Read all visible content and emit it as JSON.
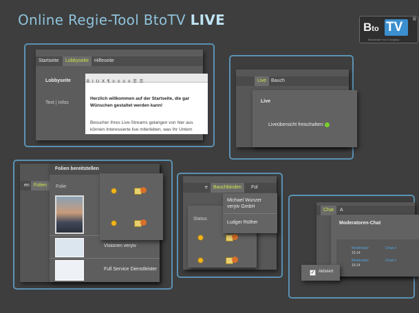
{
  "header": {
    "title": "Online Regie-Tool BtoTV",
    "title_strong": "LIVE"
  },
  "logo": {
    "left": "B",
    "left_small": "to",
    "right": "TV",
    "reg": "®",
    "tagline": "Broadcast Your Company",
    "accent": "#3b8fcf"
  },
  "colors": {
    "frame": "#5a92b4",
    "active_tab": "#cde84a",
    "status_dot": "#f2b515",
    "live_dot": "#77d22a"
  },
  "panel1": {
    "tabs": [
      "Startseite",
      "Lobbyseite",
      "Hilfeseite"
    ],
    "section_label": "Lobbyseite",
    "field_label": "Text | Infos",
    "toolbar": [
      "B",
      "I",
      "U",
      "X",
      "¶",
      "≡",
      "≡",
      "≡",
      "≡",
      "☰",
      "☰"
    ],
    "heading": "Herzlich willkommen auf der Startseite, die gar Wünschen gestaltet werden kann!",
    "body": "Besucher Ihres Live-Streams gelangen von hier aus können Interessierte live miterleben, was Ihr Untern"
  },
  "panel2": {
    "tabs": [
      "Live",
      "Bauch"
    ],
    "section_label": "Live",
    "field_label": "Liveübersicht freischalten:"
  },
  "panel3": {
    "title": "Folien bereitstellen",
    "tabs": [
      "en",
      "Folien"
    ],
    "col_label": "Folie",
    "rows": [
      "Visionen veryiv",
      "Full Service Dienstleister"
    ]
  },
  "panel4": {
    "tabs": [
      "e",
      "Bauchbinden",
      "Fol"
    ],
    "status_label": "Status",
    "names": [
      "Michael Wunzer veryiv GmbH",
      "Ludger Rüther"
    ]
  },
  "panel5": {
    "tabs": [
      "Chat",
      "A"
    ],
    "title": "Moderatoren-Chat",
    "messages": [
      {
        "name": "Moderator",
        "time": "15:14",
        "tail": "Chat n"
      },
      {
        "name": "Moderator",
        "time": "15:14",
        "tail": "Chat n"
      }
    ],
    "checkbox_label": "Aktiviert",
    "checked": true
  }
}
